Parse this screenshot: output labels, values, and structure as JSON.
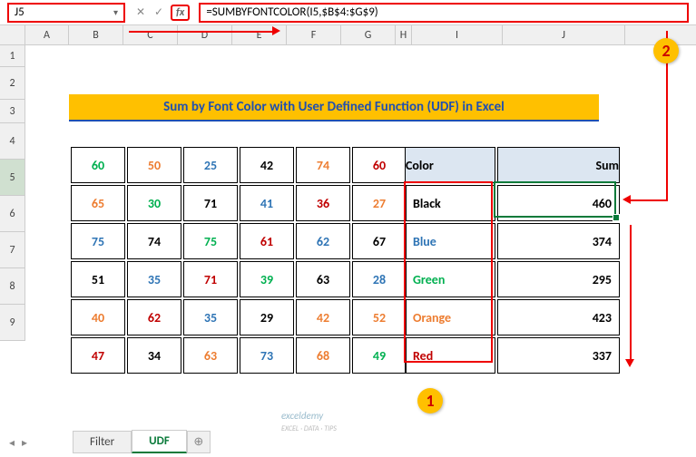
{
  "name_box": "J5",
  "formula": "=SUMBYFONTCOLOR(I5,$B$4:$G$9)",
  "columns": [
    "A",
    "B",
    "C",
    "D",
    "E",
    "F",
    "G",
    "H",
    "I",
    "J"
  ],
  "rows": [
    "1",
    "2",
    "3",
    "4",
    "5",
    "6",
    "7",
    "8",
    "9"
  ],
  "title": "Sum by Font Color with User Defined Function (UDF) in Excel",
  "data_grid": [
    [
      {
        "v": "60",
        "c": "green"
      },
      {
        "v": "50",
        "c": "orange"
      },
      {
        "v": "25",
        "c": "blue"
      },
      {
        "v": "42",
        "c": "black"
      },
      {
        "v": "74",
        "c": "orange"
      },
      {
        "v": "60",
        "c": "red"
      }
    ],
    [
      {
        "v": "65",
        "c": "orange"
      },
      {
        "v": "30",
        "c": "green"
      },
      {
        "v": "71",
        "c": "black"
      },
      {
        "v": "41",
        "c": "blue"
      },
      {
        "v": "36",
        "c": "red"
      },
      {
        "v": "27",
        "c": "orange"
      }
    ],
    [
      {
        "v": "75",
        "c": "blue"
      },
      {
        "v": "74",
        "c": "black"
      },
      {
        "v": "75",
        "c": "green"
      },
      {
        "v": "61",
        "c": "red"
      },
      {
        "v": "62",
        "c": "blue"
      },
      {
        "v": "67",
        "c": "black"
      }
    ],
    [
      {
        "v": "51",
        "c": "black"
      },
      {
        "v": "35",
        "c": "blue"
      },
      {
        "v": "71",
        "c": "red"
      },
      {
        "v": "39",
        "c": "green"
      },
      {
        "v": "63",
        "c": "black"
      },
      {
        "v": "28",
        "c": "blue"
      }
    ],
    [
      {
        "v": "40",
        "c": "orange"
      },
      {
        "v": "62",
        "c": "red"
      },
      {
        "v": "35",
        "c": "blue"
      },
      {
        "v": "29",
        "c": "black"
      },
      {
        "v": "42",
        "c": "orange"
      },
      {
        "v": "52",
        "c": "orange"
      }
    ],
    [
      {
        "v": "47",
        "c": "red"
      },
      {
        "v": "34",
        "c": "black"
      },
      {
        "v": "63",
        "c": "orange"
      },
      {
        "v": "73",
        "c": "blue"
      },
      {
        "v": "68",
        "c": "orange"
      },
      {
        "v": "49",
        "c": "green"
      }
    ]
  ],
  "sum_header": {
    "color": "Color",
    "sum": "Sum"
  },
  "sum_rows": [
    {
      "label": "Black",
      "c": "black",
      "val": "460"
    },
    {
      "label": "Blue",
      "c": "blue",
      "val": "374"
    },
    {
      "label": "Green",
      "c": "green",
      "val": "295"
    },
    {
      "label": "Orange",
      "c": "orange",
      "val": "423"
    },
    {
      "label": "Red",
      "c": "red",
      "val": "337"
    }
  ],
  "tabs": {
    "filter": "Filter",
    "udf": "UDF"
  },
  "callouts": {
    "one": "1",
    "two": "2"
  },
  "watermark": {
    "a": "exceldemy",
    "b": "EXCEL · DATA · TIPS"
  }
}
